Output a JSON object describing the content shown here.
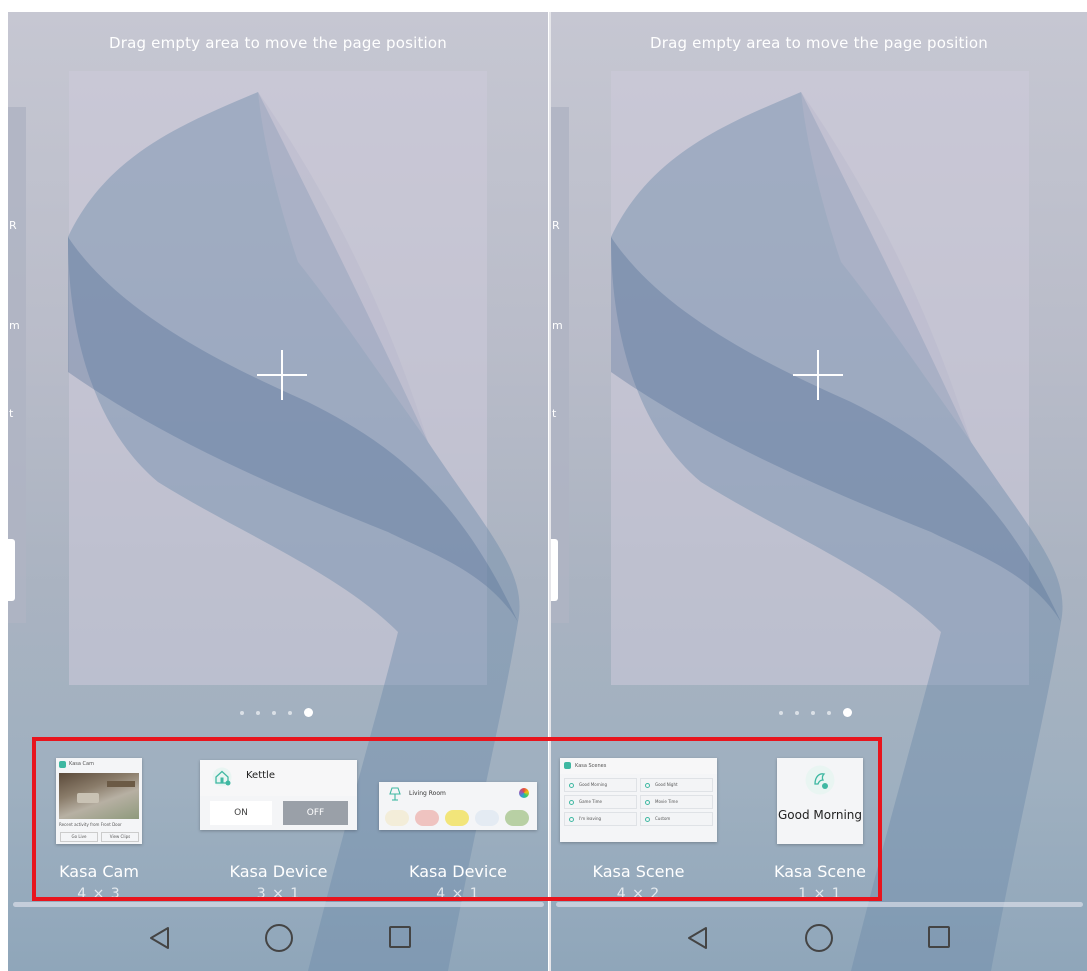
{
  "hint_text": "Drag empty area to move the page position",
  "page_indicator": {
    "count": 5,
    "active_index": 4
  },
  "widgets": {
    "kasa_cam": {
      "name": "Kasa Cam",
      "size": "4 × 3",
      "preview": {
        "title": "Kasa Cam",
        "activity": "Recent activity from Front Door",
        "go_live": "Go Live",
        "view_clips": "View Clips"
      }
    },
    "kasa_device_kettle": {
      "name": "Kasa Device",
      "size": "3 × 1",
      "preview": {
        "device_name": "Kettle",
        "on_label": "ON",
        "off_label": "OFF"
      }
    },
    "kasa_device_living": {
      "name": "Kasa Device",
      "size": "4 × 1",
      "preview": {
        "room_name": "Living Room",
        "swatch_colors": [
          "#f3edd9",
          "#efc3c0",
          "#f2e57a",
          "#e4ebf3",
          "#b8d0a4"
        ]
      }
    },
    "kasa_scene_list": {
      "name": "Kasa Scene",
      "size": "4 × 2",
      "preview": {
        "title": "Kasa Scenes",
        "scenes": [
          "Good Morning",
          "Good Night",
          "Game Time",
          "Movie Time",
          "I'm leaving",
          "Custom"
        ]
      }
    },
    "kasa_scene_single": {
      "name": "Kasa Scene",
      "size": "1 × 1",
      "preview": {
        "scene_name": "Good Morning"
      }
    }
  },
  "colors": {
    "highlight": "#e8141d",
    "accent": "#3fb8a2"
  },
  "icons": {
    "add": "plus-icon",
    "back": "back-triangle-icon",
    "home": "home-circle-icon",
    "recents": "recents-square-icon"
  }
}
